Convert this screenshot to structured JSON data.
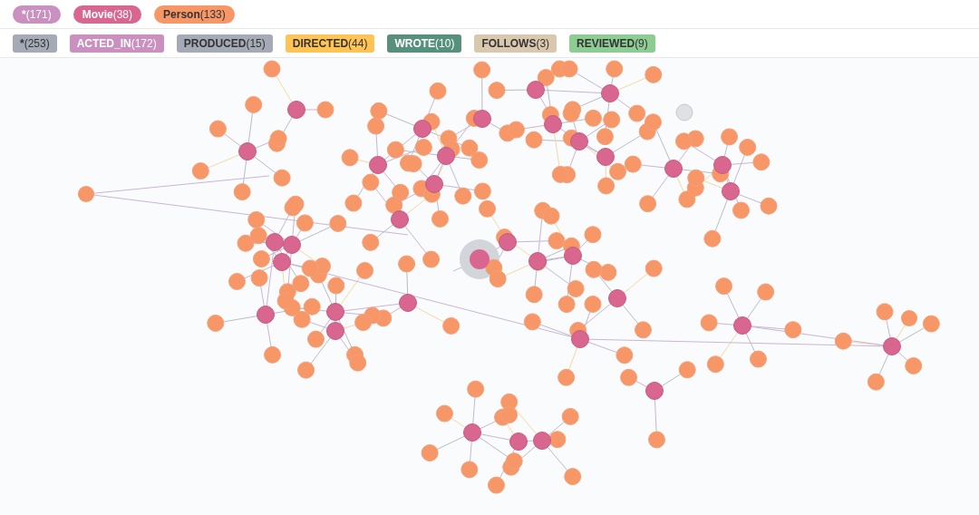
{
  "node_labels": [
    {
      "label": "*",
      "count": "(171)",
      "color": "#c990c0"
    },
    {
      "label": "Movie",
      "count": "(38)",
      "color": "#d9668f"
    },
    {
      "label": "Person",
      "count": "(133)",
      "color": "#f79767"
    }
  ],
  "relationship_types": [
    {
      "label": "*",
      "count": "(253)",
      "color": "#a5abb6"
    },
    {
      "label": "ACTED_IN",
      "count": "(172)",
      "color": "#c990c0"
    },
    {
      "label": "PRODUCED",
      "count": "(15)",
      "color": "#a5abb6"
    },
    {
      "label": "DIRECTED",
      "count": "(44)",
      "color": "#ffc454"
    },
    {
      "label": "WROTE",
      "count": "(10)",
      "color": "#57907c"
    },
    {
      "label": "FOLLOWS",
      "count": "(3)",
      "color": "#d9c8ae"
    },
    {
      "label": "REVIEWED",
      "count": "(9)",
      "color": "#8dcc93"
    }
  ]
}
